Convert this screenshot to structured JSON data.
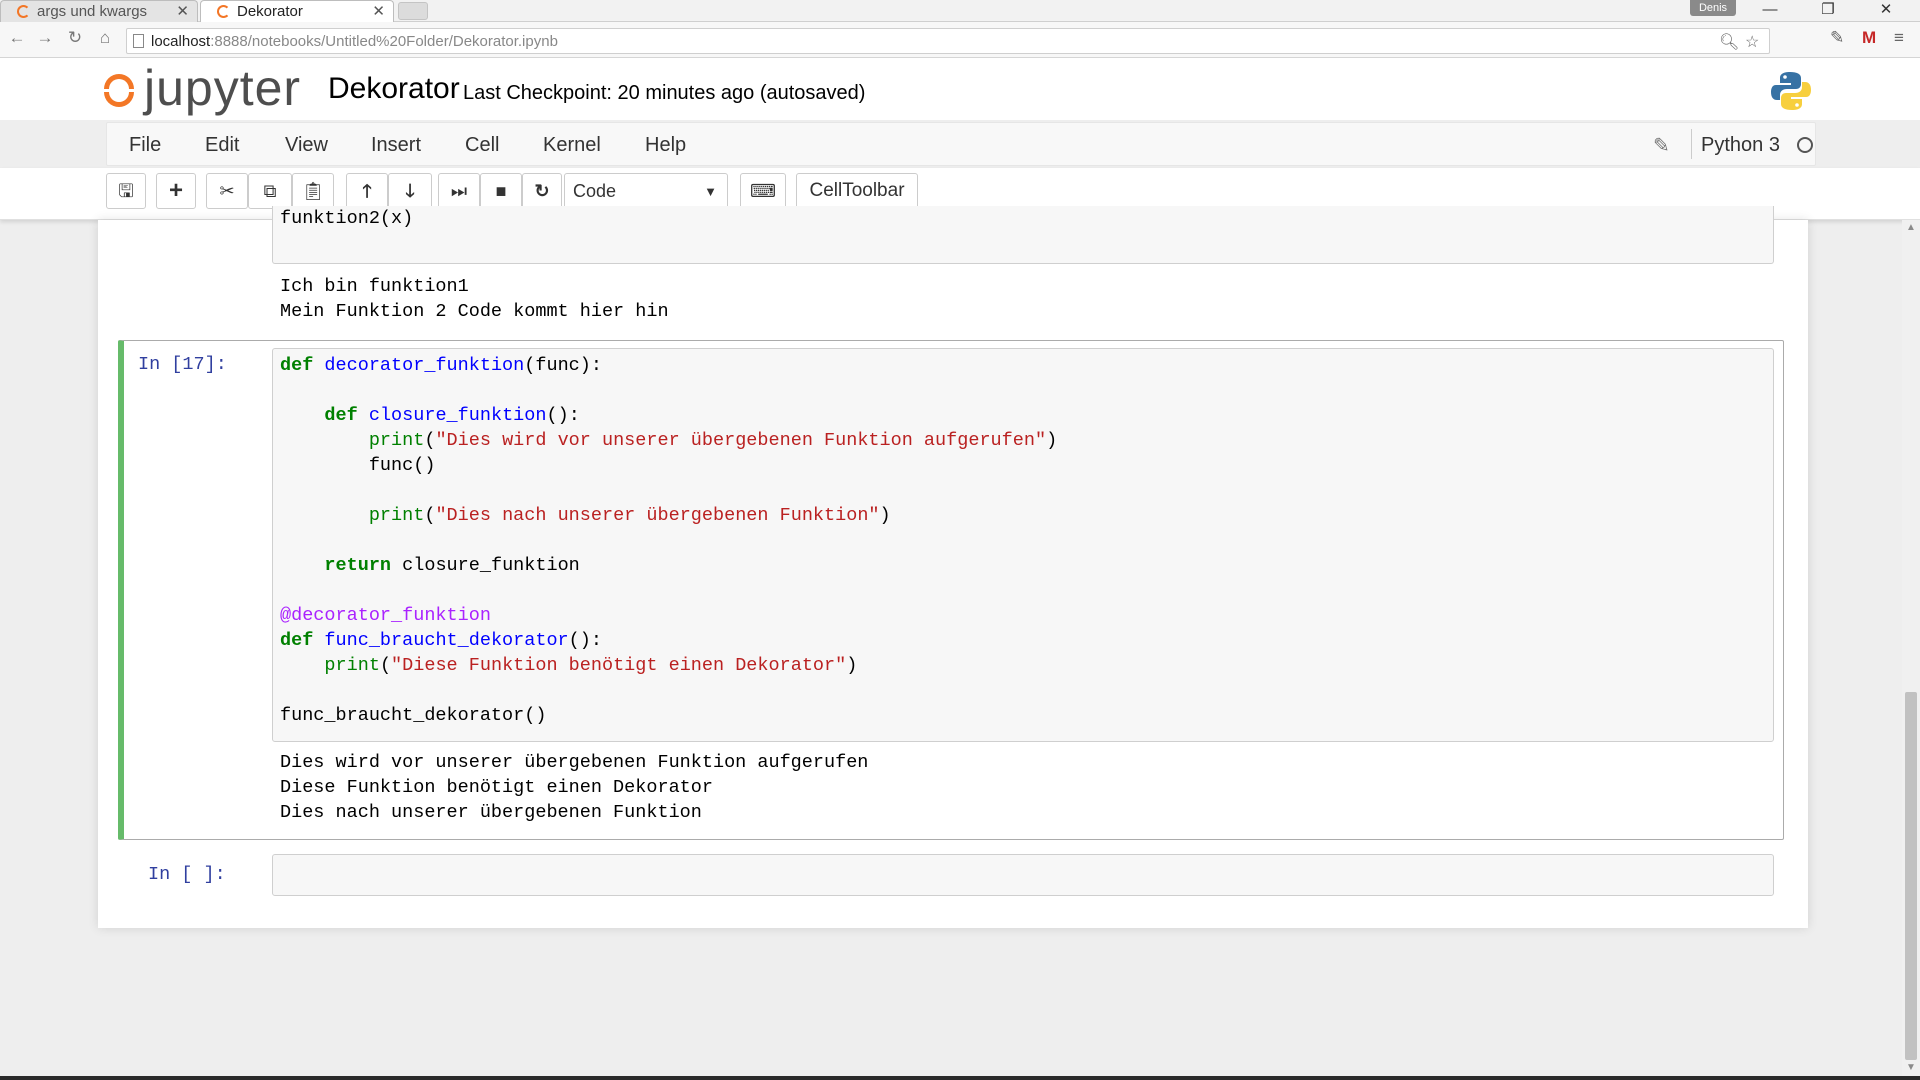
{
  "browser": {
    "tabs": [
      {
        "title": "args und kwargs"
      },
      {
        "title": "Dekorator"
      }
    ],
    "tab_close": "✕",
    "user_badge": "Denis",
    "window_buttons": {
      "minimize": "—",
      "restore": "❐",
      "close": "✕"
    },
    "url_host": "localhost",
    "url_rest": ":8888/notebooks/Untitled%20Folder/Dekorator.ipynb"
  },
  "jupyter": {
    "logo_text": "jupyter",
    "notebook_name": "Dekorator",
    "checkpoint": "Last Checkpoint: 20 minutes ago (autosaved)",
    "menu": [
      "File",
      "Edit",
      "View",
      "Insert",
      "Cell",
      "Kernel",
      "Help"
    ],
    "kernel_name": "Python 3",
    "toolbar": {
      "cell_type": "Code",
      "celltoolbar_label": "CellToolbar"
    },
    "colors": {
      "accent_orange": "#f37726",
      "selected_cell_border": "#66bb6a",
      "prompt_blue": "#303f9f"
    }
  },
  "notebook": {
    "previous_cell": {
      "partial_input": "funktion2(x)",
      "output": [
        "Ich bin funktion1",
        "Mein Funktion 2 Code kommt hier hin"
      ]
    },
    "current_cell": {
      "prompt": "In [17]:",
      "output": [
        "Dies wird vor unserer übergebenen Funktion aufgerufen",
        "Diese Funktion benötigt einen Dekorator",
        "Dies nach unserer übergebenen Funktion"
      ]
    },
    "empty_cell": {
      "prompt": "In [ ]:"
    }
  }
}
